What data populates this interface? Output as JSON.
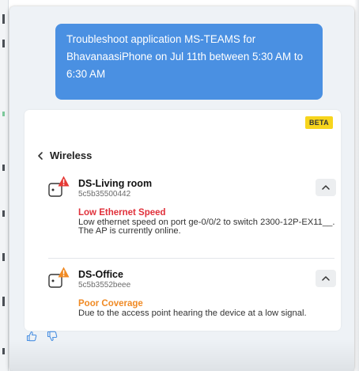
{
  "chat": {
    "user_message": "Troubleshoot application MS-TEAMS for BhavanaasiPhone on Jul 11th between 5:30 AM to 6:30 AM"
  },
  "card": {
    "badge": "BETA",
    "section_title": "Wireless",
    "devices": [
      {
        "name": "DS-Living room",
        "mac": "5c5b35500442",
        "issue": "Low Ethernet Speed",
        "issue_color": "#e0303a",
        "warn_color": "#e53935",
        "description": "Low ethernet speed on port ge-0/0/2 to switch 2300-12P-EX11__. The AP is currently online."
      },
      {
        "name": "DS-Office",
        "mac": "5c5b3552beee",
        "issue": "Poor Coverage",
        "issue_color": "#f08a24",
        "warn_color": "#f08a24",
        "description": "Due to the access point hearing the device at a low signal."
      }
    ]
  },
  "colors": {
    "accent": "#4a90e2",
    "badge": "#f7d51d",
    "feedback_icon": "#4a90e2"
  },
  "icons": {
    "back": "chevron-left-icon",
    "device": "access-point-icon",
    "warning": "warning-triangle-icon",
    "collapse": "chevron-up-icon",
    "like": "thumbs-up-icon",
    "dislike": "thumbs-down-icon"
  }
}
